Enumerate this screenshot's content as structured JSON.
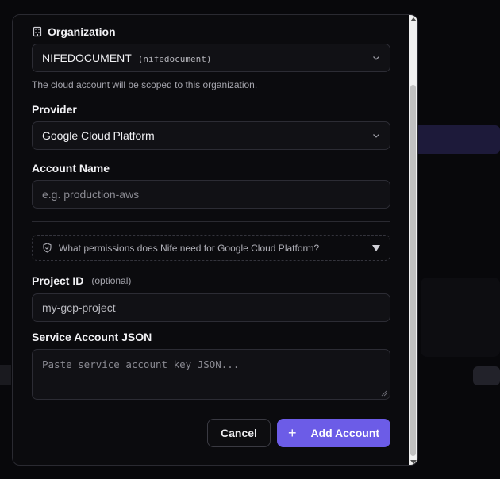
{
  "organization": {
    "label": "Organization",
    "selected_name": "NIFEDOCUMENT",
    "selected_slug": "(nifedocument)",
    "help": "The cloud account will be scoped to this organization."
  },
  "provider": {
    "label": "Provider",
    "selected": "Google Cloud Platform"
  },
  "account_name": {
    "label": "Account Name",
    "placeholder": "e.g. production-aws"
  },
  "permissions": {
    "text": "What permissions does Nife need for Google Cloud Platform?"
  },
  "project_id": {
    "label": "Project ID",
    "optional": "(optional)",
    "value": "my-gcp-project"
  },
  "service_account": {
    "label": "Service Account JSON",
    "placeholder": "Paste service account key JSON..."
  },
  "actions": {
    "cancel": "Cancel",
    "add": "Add Account"
  },
  "colors": {
    "accent": "#6c5ce7",
    "panel": "#0b0b0e",
    "border": "#2a2a31"
  }
}
